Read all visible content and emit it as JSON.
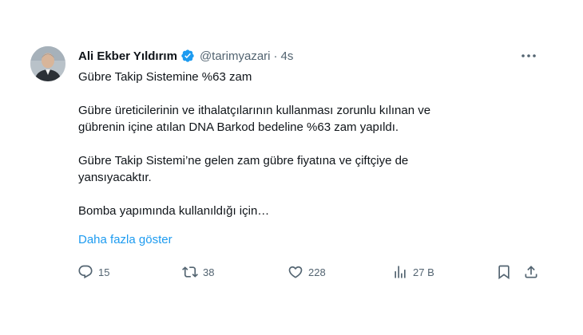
{
  "author": {
    "name": "Ali Ekber Yıldırım",
    "handle": "@tarimyazari",
    "separator": "·",
    "time": "4s",
    "verified": true
  },
  "tweet": {
    "paragraphs": [
      [
        "Gübre Takip Sistemine %63 zam"
      ],
      [
        "Gübre üreticilerinin ve ithalatçılarının kullanması zorunlu kılınan ve",
        "gübrenin içine atılan DNA Barkod bedeline %63 zam yapıldı."
      ],
      [
        "Gübre Takip Sistemi’ne gelen zam gübre fiyatına ve çiftçiye de",
        "yansıyacaktır."
      ],
      [
        "Bomba yapımında kullanıldığı için…"
      ]
    ],
    "show_more": "Daha fazla göster"
  },
  "actions": {
    "replies": "15",
    "retweets": "38",
    "likes": "228",
    "views": "27 B"
  },
  "colors": {
    "text": "#0f1419",
    "muted": "#536471",
    "link": "#1d9bf0",
    "verified_badge": "#1d9bf0"
  },
  "icons": [
    "more-icon",
    "verified-icon",
    "reply-icon",
    "retweet-icon",
    "like-icon",
    "views-icon",
    "bookmark-icon",
    "share-icon"
  ]
}
